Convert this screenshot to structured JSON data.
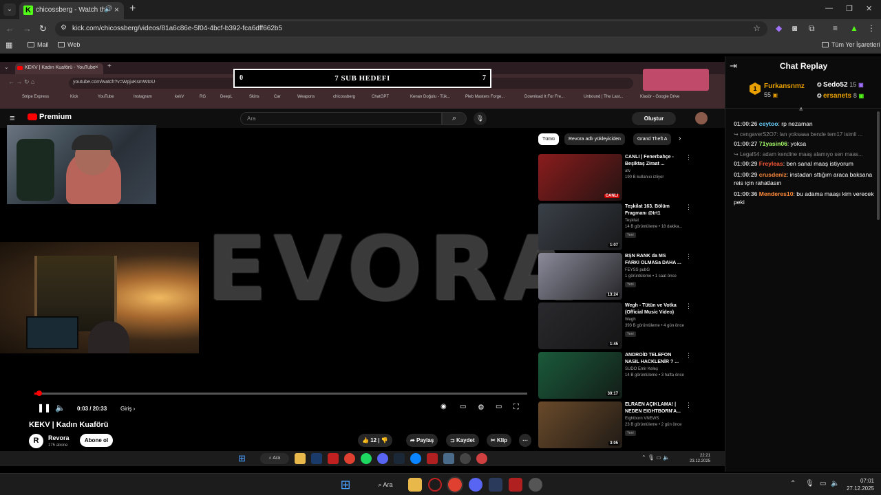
{
  "browser": {
    "tab_title": "chicossberg - Watch the VOD",
    "url": "kick.com/chicossberg/videos/81a6c86e-5f04-4bcf-b392-fca6dff662b5",
    "bookmarks": [
      "Mail",
      "Web"
    ],
    "all_bookmarks": "Tüm Yer İşaretleri"
  },
  "inner_browser": {
    "tab_title": "KEKV | Kadın Kuaförü - YouTube",
    "url": "youtube.com/watch?v=WpjuKsmWtoU",
    "bookmarks": [
      "Stripe Express",
      "Kick",
      "YouTube",
      "Instagram",
      "kekV",
      "RG",
      "DeepL",
      "Skins",
      "Car",
      "Weapons",
      "chicossberg",
      "ChatGPT",
      "Kenan Doğulu - Tük...",
      "Pleb Masters Forge...",
      "Download It For Fre...",
      "Unbound | The Last...",
      "Klasör - Google Drive"
    ]
  },
  "sub_goal": {
    "start": "0",
    "title": "7 SUB HEDEFI",
    "end": "7"
  },
  "youtube": {
    "logo": "Premium",
    "search_placeholder": "Ara",
    "create": "Oluştur",
    "video_title": "KEKV | Kadın Kuaförü",
    "video_overlay_text": "EVORA",
    "time": "0:03 / 20:33",
    "chapter": "Giriş",
    "progress": 0.003,
    "channel_name": "Revora",
    "channel_subs": "175 abone",
    "subscribe": "Abone ol",
    "likes": "12",
    "share": "Paylaş",
    "save": "Kaydet",
    "clip": "Klip",
    "chips": [
      "Tümü",
      "Revora adlı yükleyiciden",
      "Grand Theft A"
    ],
    "recommendations": [
      {
        "title": "CANLI | Fenerbahçe - Beşiktaş Ziraat ...",
        "channel": "atv",
        "meta": "190 B kullanıcı izliyor",
        "badge": "",
        "duration": "CANLI",
        "color": "#8a1c1c"
      },
      {
        "title": "Teşkilat 163. Bölüm Fragmanı @trt1",
        "channel": "Teşkilat",
        "meta": "14 B görüntüleme • 18 dakika...",
        "badge": "Yeni",
        "duration": "1:07",
        "color": "#3a4048"
      },
      {
        "title": "BŞN RANK da MS FARKI OLMASa DAHA ...",
        "channel": "FEYSS pubG",
        "meta": "1 görüntüleme • 1 saat önce",
        "badge": "Yeni",
        "duration": "13:24",
        "color": "#8a8a9a"
      },
      {
        "title": "Wegh - Tütün ve Votka (Official Music Video)",
        "channel": "Wegh",
        "meta": "393 B görüntüleme • 4 gün önce",
        "badge": "Yeni",
        "duration": "1:45",
        "color": "#2a2a2e"
      },
      {
        "title": "ANDROİD TELEFON NASIL HACKLENİR ? ...",
        "channel": "SUDO Emir Keleş",
        "meta": "14 B görüntüleme • 3 hafta önce",
        "badge": "",
        "duration": "30:17",
        "color": "#1a5a3a"
      },
      {
        "title": "ELRAEN AÇIKLAMA! | NEDEN EIGHTBORN'A...",
        "channel": "Eightborn VNEWS",
        "meta": "23 B görüntüleme • 2 gün önce",
        "badge": "Yeni",
        "duration": "3:05",
        "color": "#6a4a2a"
      }
    ],
    "inner_taskbar_search": "Ara",
    "inner_time": "22:21",
    "inner_date": "23.12.2025"
  },
  "chat": {
    "title": "Chat Replay",
    "leader1": {
      "rank": "1",
      "name": "Furkansnmz",
      "count": "55"
    },
    "leader2": {
      "name": "Sedo52",
      "count": "15"
    },
    "leader3": {
      "name": "ersanets",
      "count": "8"
    },
    "messages": [
      {
        "reply": "",
        "time": "01:00:26",
        "user": "ceytoo",
        "color": "#6ad0ff",
        "text": ": rp nezaman"
      },
      {
        "reply": "cengaverS2O7: lan yoksaaa bende tem17 isimli ...",
        "time": "01:00:27",
        "user": "71yasin06",
        "color": "#a8ff6a",
        "text": ": yoksa"
      },
      {
        "reply": "Legal54: adam kendine maaş alamıyo sen maas...",
        "time": "01:00:29",
        "user": "Freyleas",
        "color": "#ff5a3a",
        "text": ": ben sanal maaş istiyorum"
      },
      {
        "reply": "",
        "time": "01:00:29",
        "user": "crusdeniz",
        "color": "#ff8a3a",
        "text": ": instadan sttığım araca baksana reis için rahatlasın"
      },
      {
        "reply": "",
        "time": "01:00:36",
        "user": "Menderes10",
        "color": "#ff8a3a",
        "text": ": bu adama maaşı kim verecek peki"
      }
    ]
  },
  "taskbar": {
    "search": "Ara",
    "time": "07:01",
    "date": "27.12.2025"
  }
}
